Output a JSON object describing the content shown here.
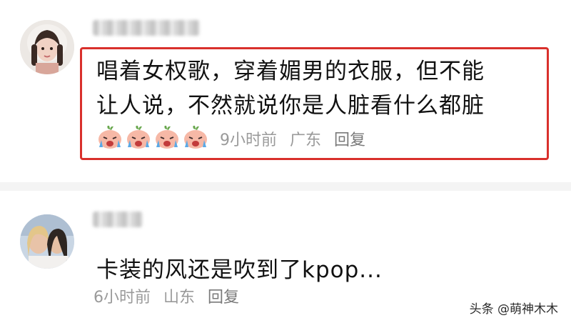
{
  "comments": [
    {
      "text_line1": "唱着女权歌，穿着媚男的衣服，但不能",
      "text_line2": "让人说，不然就说你是人脏看什么都脏",
      "time": "9小时前",
      "location": "广东",
      "reply_label": "回复",
      "emoji_icons": [
        "crying-face-icon",
        "crying-face-icon",
        "crying-face-icon",
        "crying-face-icon"
      ],
      "highlight_color": "#d9302c"
    },
    {
      "text_line1": "卡装的风还是吹到了kpop...",
      "time": "6小时前",
      "location": "山东",
      "reply_label": "回复"
    }
  ],
  "watermark": "头条 @萌神木木"
}
